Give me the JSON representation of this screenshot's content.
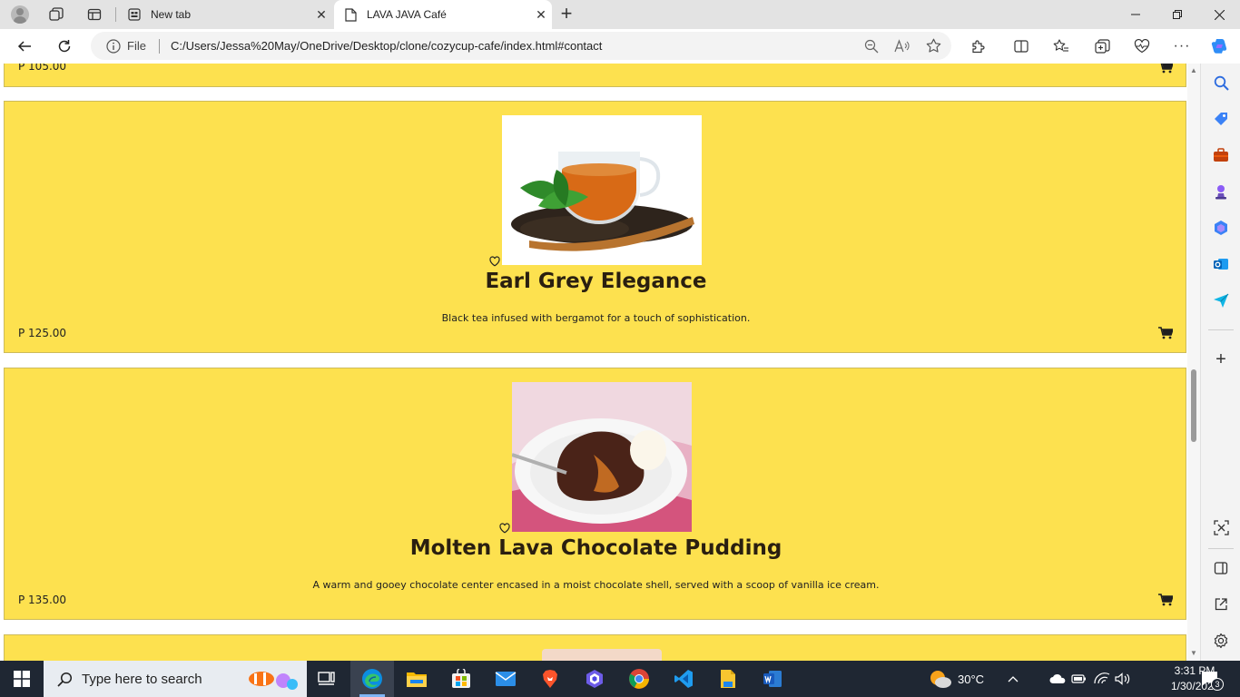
{
  "browser": {
    "tabs": [
      {
        "title": "New tab",
        "active": false
      },
      {
        "title": "LAVA JAVA Café",
        "active": true
      }
    ],
    "address": {
      "scheme_label": "File",
      "url": "C:/Users/Jessa%20May/OneDrive/Desktop/clone/cozycup-cafe/index.html#contact"
    },
    "window_controls": [
      "minimize",
      "restore",
      "close"
    ]
  },
  "page": {
    "background": "#fde14f",
    "items": [
      {
        "price": "P 105.00"
      },
      {
        "name": "Earl Grey Elegance",
        "description": "Black tea infused with bergamot for a touch of sophistication.",
        "price": "P 125.00",
        "image": "earl-grey-tea-cup-image"
      },
      {
        "name": "Molten Lava Chocolate Pudding",
        "description": "A warm and gooey chocolate center encased in a moist chocolate shell, served with a scoop of vanilla ice cream.",
        "price": "P 135.00",
        "image": "chocolate-lava-pudding-image"
      }
    ]
  },
  "taskbar": {
    "search_placeholder": "Type here to search",
    "weather": "30°C",
    "time": "3:31 PM",
    "date": "1/30/2024",
    "notification_count": "3",
    "apps": [
      "task-view",
      "edge",
      "file-explorer",
      "microsoft-store",
      "mail",
      "brave",
      "app",
      "chrome",
      "vscode",
      "sticky-notes",
      "word"
    ]
  }
}
